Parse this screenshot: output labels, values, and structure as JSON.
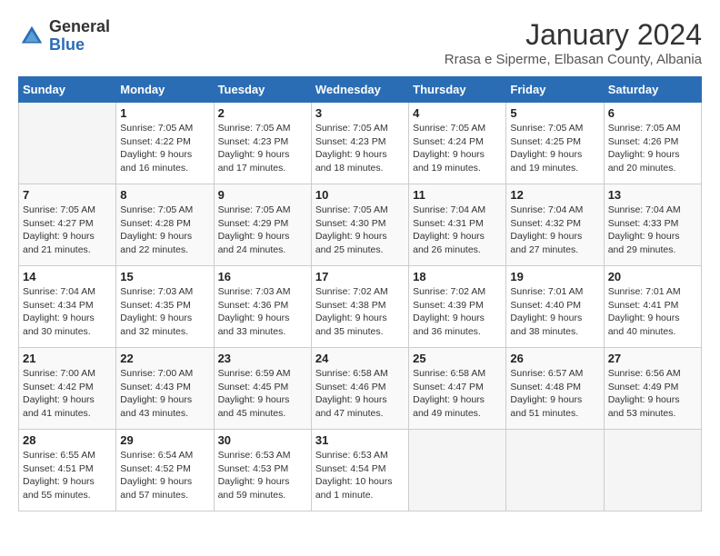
{
  "logo": {
    "general": "General",
    "blue": "Blue"
  },
  "header": {
    "month": "January 2024",
    "location": "Rrasa e Siperme, Elbasan County, Albania"
  },
  "weekdays": [
    "Sunday",
    "Monday",
    "Tuesday",
    "Wednesday",
    "Thursday",
    "Friday",
    "Saturday"
  ],
  "weeks": [
    [
      {
        "day": "",
        "empty": true
      },
      {
        "day": "1",
        "sunrise": "7:05 AM",
        "sunset": "4:22 PM",
        "daylight": "9 hours and 16 minutes."
      },
      {
        "day": "2",
        "sunrise": "7:05 AM",
        "sunset": "4:23 PM",
        "daylight": "9 hours and 17 minutes."
      },
      {
        "day": "3",
        "sunrise": "7:05 AM",
        "sunset": "4:23 PM",
        "daylight": "9 hours and 18 minutes."
      },
      {
        "day": "4",
        "sunrise": "7:05 AM",
        "sunset": "4:24 PM",
        "daylight": "9 hours and 19 minutes."
      },
      {
        "day": "5",
        "sunrise": "7:05 AM",
        "sunset": "4:25 PM",
        "daylight": "9 hours and 19 minutes."
      },
      {
        "day": "6",
        "sunrise": "7:05 AM",
        "sunset": "4:26 PM",
        "daylight": "9 hours and 20 minutes."
      }
    ],
    [
      {
        "day": "7",
        "sunrise": "7:05 AM",
        "sunset": "4:27 PM",
        "daylight": "9 hours and 21 minutes."
      },
      {
        "day": "8",
        "sunrise": "7:05 AM",
        "sunset": "4:28 PM",
        "daylight": "9 hours and 22 minutes."
      },
      {
        "day": "9",
        "sunrise": "7:05 AM",
        "sunset": "4:29 PM",
        "daylight": "9 hours and 24 minutes."
      },
      {
        "day": "10",
        "sunrise": "7:05 AM",
        "sunset": "4:30 PM",
        "daylight": "9 hours and 25 minutes."
      },
      {
        "day": "11",
        "sunrise": "7:04 AM",
        "sunset": "4:31 PM",
        "daylight": "9 hours and 26 minutes."
      },
      {
        "day": "12",
        "sunrise": "7:04 AM",
        "sunset": "4:32 PM",
        "daylight": "9 hours and 27 minutes."
      },
      {
        "day": "13",
        "sunrise": "7:04 AM",
        "sunset": "4:33 PM",
        "daylight": "9 hours and 29 minutes."
      }
    ],
    [
      {
        "day": "14",
        "sunrise": "7:04 AM",
        "sunset": "4:34 PM",
        "daylight": "9 hours and 30 minutes."
      },
      {
        "day": "15",
        "sunrise": "7:03 AM",
        "sunset": "4:35 PM",
        "daylight": "9 hours and 32 minutes."
      },
      {
        "day": "16",
        "sunrise": "7:03 AM",
        "sunset": "4:36 PM",
        "daylight": "9 hours and 33 minutes."
      },
      {
        "day": "17",
        "sunrise": "7:02 AM",
        "sunset": "4:38 PM",
        "daylight": "9 hours and 35 minutes."
      },
      {
        "day": "18",
        "sunrise": "7:02 AM",
        "sunset": "4:39 PM",
        "daylight": "9 hours and 36 minutes."
      },
      {
        "day": "19",
        "sunrise": "7:01 AM",
        "sunset": "4:40 PM",
        "daylight": "9 hours and 38 minutes."
      },
      {
        "day": "20",
        "sunrise": "7:01 AM",
        "sunset": "4:41 PM",
        "daylight": "9 hours and 40 minutes."
      }
    ],
    [
      {
        "day": "21",
        "sunrise": "7:00 AM",
        "sunset": "4:42 PM",
        "daylight": "9 hours and 41 minutes."
      },
      {
        "day": "22",
        "sunrise": "7:00 AM",
        "sunset": "4:43 PM",
        "daylight": "9 hours and 43 minutes."
      },
      {
        "day": "23",
        "sunrise": "6:59 AM",
        "sunset": "4:45 PM",
        "daylight": "9 hours and 45 minutes."
      },
      {
        "day": "24",
        "sunrise": "6:58 AM",
        "sunset": "4:46 PM",
        "daylight": "9 hours and 47 minutes."
      },
      {
        "day": "25",
        "sunrise": "6:58 AM",
        "sunset": "4:47 PM",
        "daylight": "9 hours and 49 minutes."
      },
      {
        "day": "26",
        "sunrise": "6:57 AM",
        "sunset": "4:48 PM",
        "daylight": "9 hours and 51 minutes."
      },
      {
        "day": "27",
        "sunrise": "6:56 AM",
        "sunset": "4:49 PM",
        "daylight": "9 hours and 53 minutes."
      }
    ],
    [
      {
        "day": "28",
        "sunrise": "6:55 AM",
        "sunset": "4:51 PM",
        "daylight": "9 hours and 55 minutes."
      },
      {
        "day": "29",
        "sunrise": "6:54 AM",
        "sunset": "4:52 PM",
        "daylight": "9 hours and 57 minutes."
      },
      {
        "day": "30",
        "sunrise": "6:53 AM",
        "sunset": "4:53 PM",
        "daylight": "9 hours and 59 minutes."
      },
      {
        "day": "31",
        "sunrise": "6:53 AM",
        "sunset": "4:54 PM",
        "daylight": "10 hours and 1 minute."
      },
      {
        "day": "",
        "empty": true
      },
      {
        "day": "",
        "empty": true
      },
      {
        "day": "",
        "empty": true
      }
    ]
  ]
}
